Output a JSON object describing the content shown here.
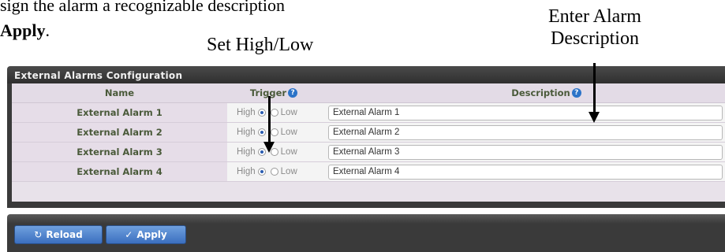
{
  "document": {
    "line1": "sign the alarm a recognizable description",
    "line2_bold": "Apply",
    "line2_rest": ".",
    "callout_set": "Set High/Low",
    "callout_enter_1": "Enter Alarm",
    "callout_enter_2": "Description"
  },
  "panel": {
    "title": "External Alarms Configuration",
    "headers": {
      "name": "Name",
      "trigger": "Trigger",
      "description": "Description",
      "help_glyph": "?"
    },
    "trigger_options": {
      "high": "High",
      "low": "Low"
    },
    "rows": [
      {
        "name": "External Alarm 1",
        "trigger": "High",
        "description": "External Alarm 1"
      },
      {
        "name": "External Alarm 2",
        "trigger": "High",
        "description": "External Alarm 2"
      },
      {
        "name": "External Alarm 3",
        "trigger": "High",
        "description": "External Alarm 3"
      },
      {
        "name": "External Alarm 4",
        "trigger": "High",
        "description": "External Alarm 4"
      }
    ]
  },
  "toolbar": {
    "reload_label": "Reload",
    "reload_icon": "refresh-icon",
    "apply_label": "Apply",
    "apply_icon": "check-icon"
  },
  "colors": {
    "panel_dark": "#3a3a3a",
    "table_bg": "#e6dde8",
    "label_green": "#4a5a3a",
    "button_blue": "#3b6fbf",
    "help_blue": "#2c73c8"
  }
}
